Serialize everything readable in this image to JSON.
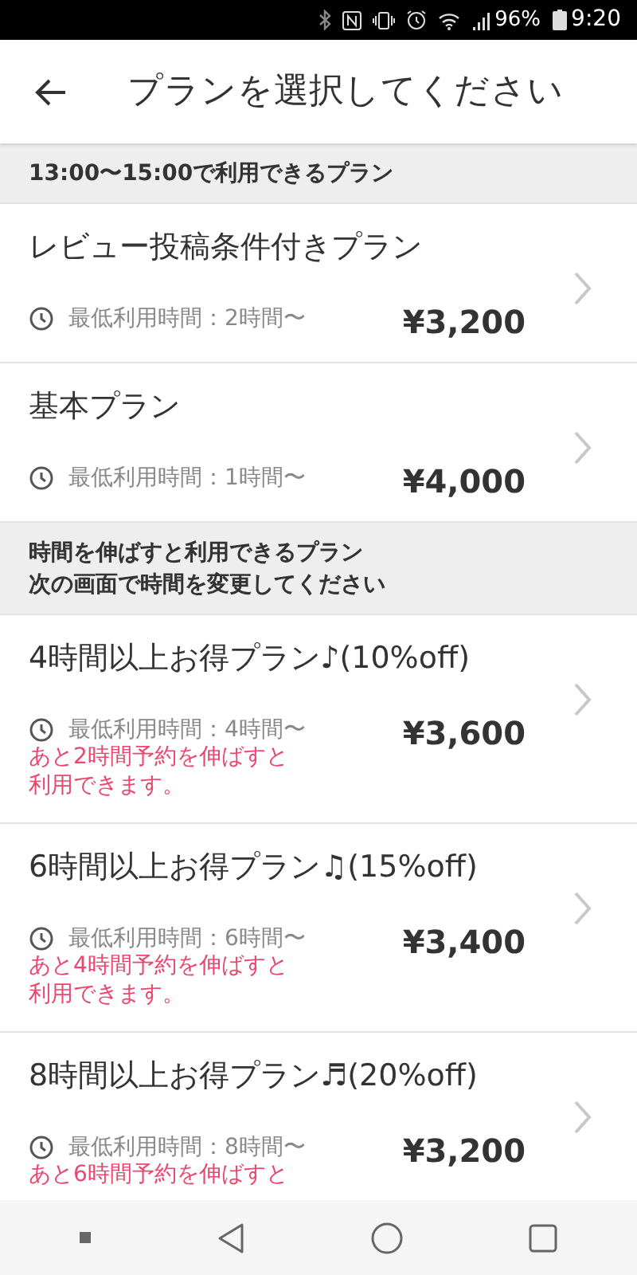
{
  "status_bar": {
    "battery": "96%",
    "time": "9:20"
  },
  "app_bar": {
    "title": "プランを選択してください"
  },
  "sections": [
    {
      "header_lines": [
        "13:00〜15:00で利用できるプラン"
      ],
      "plans": [
        {
          "name": "レビュー投稿条件付きプラン",
          "min_time": "最低利用時間：2時間〜",
          "price": "¥3,200"
        },
        {
          "name": "基本プラン",
          "min_time": "最低利用時間：1時間〜",
          "price": "¥4,000"
        }
      ]
    },
    {
      "header_lines": [
        "時間を伸ばすと利用できるプラン",
        "次の画面で時間を変更してください"
      ],
      "plans": [
        {
          "name": "4時間以上お得プラン♪(10%off)",
          "min_time": "最低利用時間：4時間〜",
          "price": "¥3,600",
          "note_lines": [
            "あと2時間予約を伸ばすと",
            "利用できます。"
          ]
        },
        {
          "name": "6時間以上お得プラン♫(15%off)",
          "min_time": "最低利用時間：6時間〜",
          "price": "¥3,400",
          "note_lines": [
            "あと4時間予約を伸ばすと",
            "利用できます。"
          ]
        },
        {
          "name": "8時間以上お得プラン♬(20%off)",
          "min_time": "最低利用時間：8時間〜",
          "price": "¥3,200",
          "note_lines": [
            "あと6時間予約を伸ばすと"
          ]
        }
      ]
    }
  ]
}
